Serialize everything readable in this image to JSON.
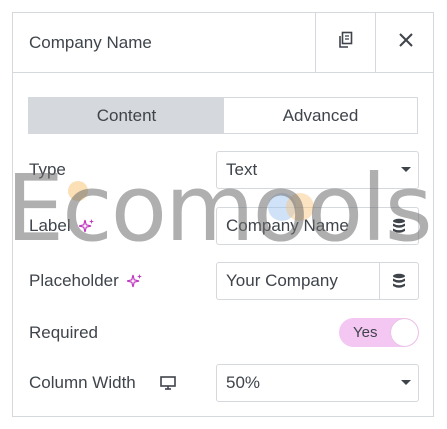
{
  "header": {
    "title": "Company Name",
    "copy_icon": "copy-icon",
    "close_icon": "close-icon"
  },
  "tabs": [
    {
      "label": "Content",
      "active": true
    },
    {
      "label": "Advanced",
      "active": false
    }
  ],
  "fields": {
    "type": {
      "label": "Type",
      "value": "Text"
    },
    "label": {
      "label": "Label",
      "value": "Company Name"
    },
    "placeholder": {
      "label": "Placeholder",
      "value": "Your Company"
    },
    "required": {
      "label": "Required",
      "toggle_text": "Yes",
      "on": true
    },
    "column_width": {
      "label": "Column Width",
      "value": "50%"
    }
  },
  "watermark": "Ecomools",
  "colors": {
    "border": "#d5d8dc",
    "text": "#3f444b",
    "tab_active_bg": "#d5d8dc",
    "toggle_on": "#f4c6f2",
    "ai_sparkle": "#c036c0"
  }
}
